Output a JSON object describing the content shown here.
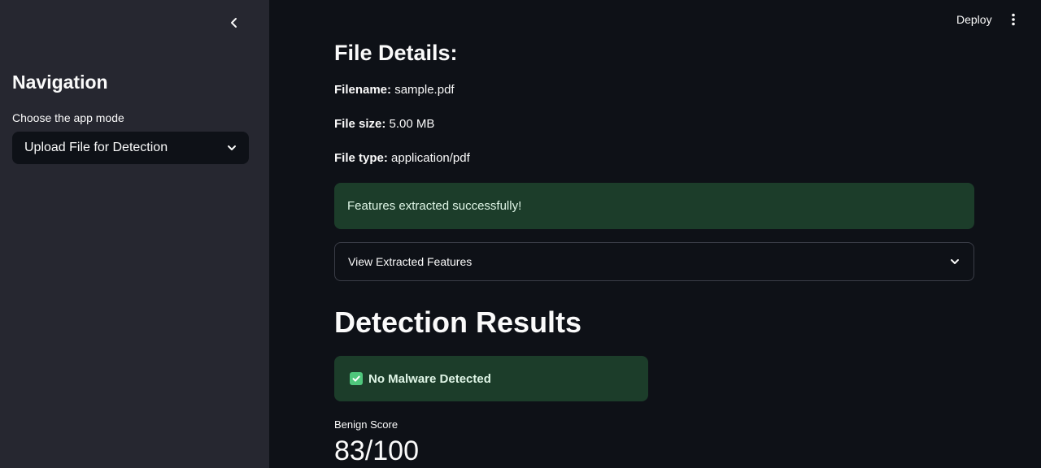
{
  "sidebar": {
    "title": "Navigation",
    "mode_label": "Choose the app mode",
    "mode_value": "Upload File for Detection"
  },
  "header": {
    "deploy_label": "Deploy"
  },
  "file_details": {
    "heading": "File Details:",
    "filename_label": "Filename:",
    "filename_value": "sample.pdf",
    "size_label": "File size:",
    "size_value": "5.00 MB",
    "type_label": "File type:",
    "type_value": "application/pdf"
  },
  "status": {
    "success_message": "Features extracted successfully!"
  },
  "expander": {
    "label": "View Extracted Features"
  },
  "results": {
    "heading": "Detection Results",
    "verdict": "No Malware Detected",
    "metric_label": "Benign Score",
    "metric_value": "83/100"
  },
  "colors": {
    "sidebar_bg": "#262730",
    "main_bg": "#0e1117",
    "success_bg": "#1c3d2a",
    "check_green": "#4fc77c"
  }
}
